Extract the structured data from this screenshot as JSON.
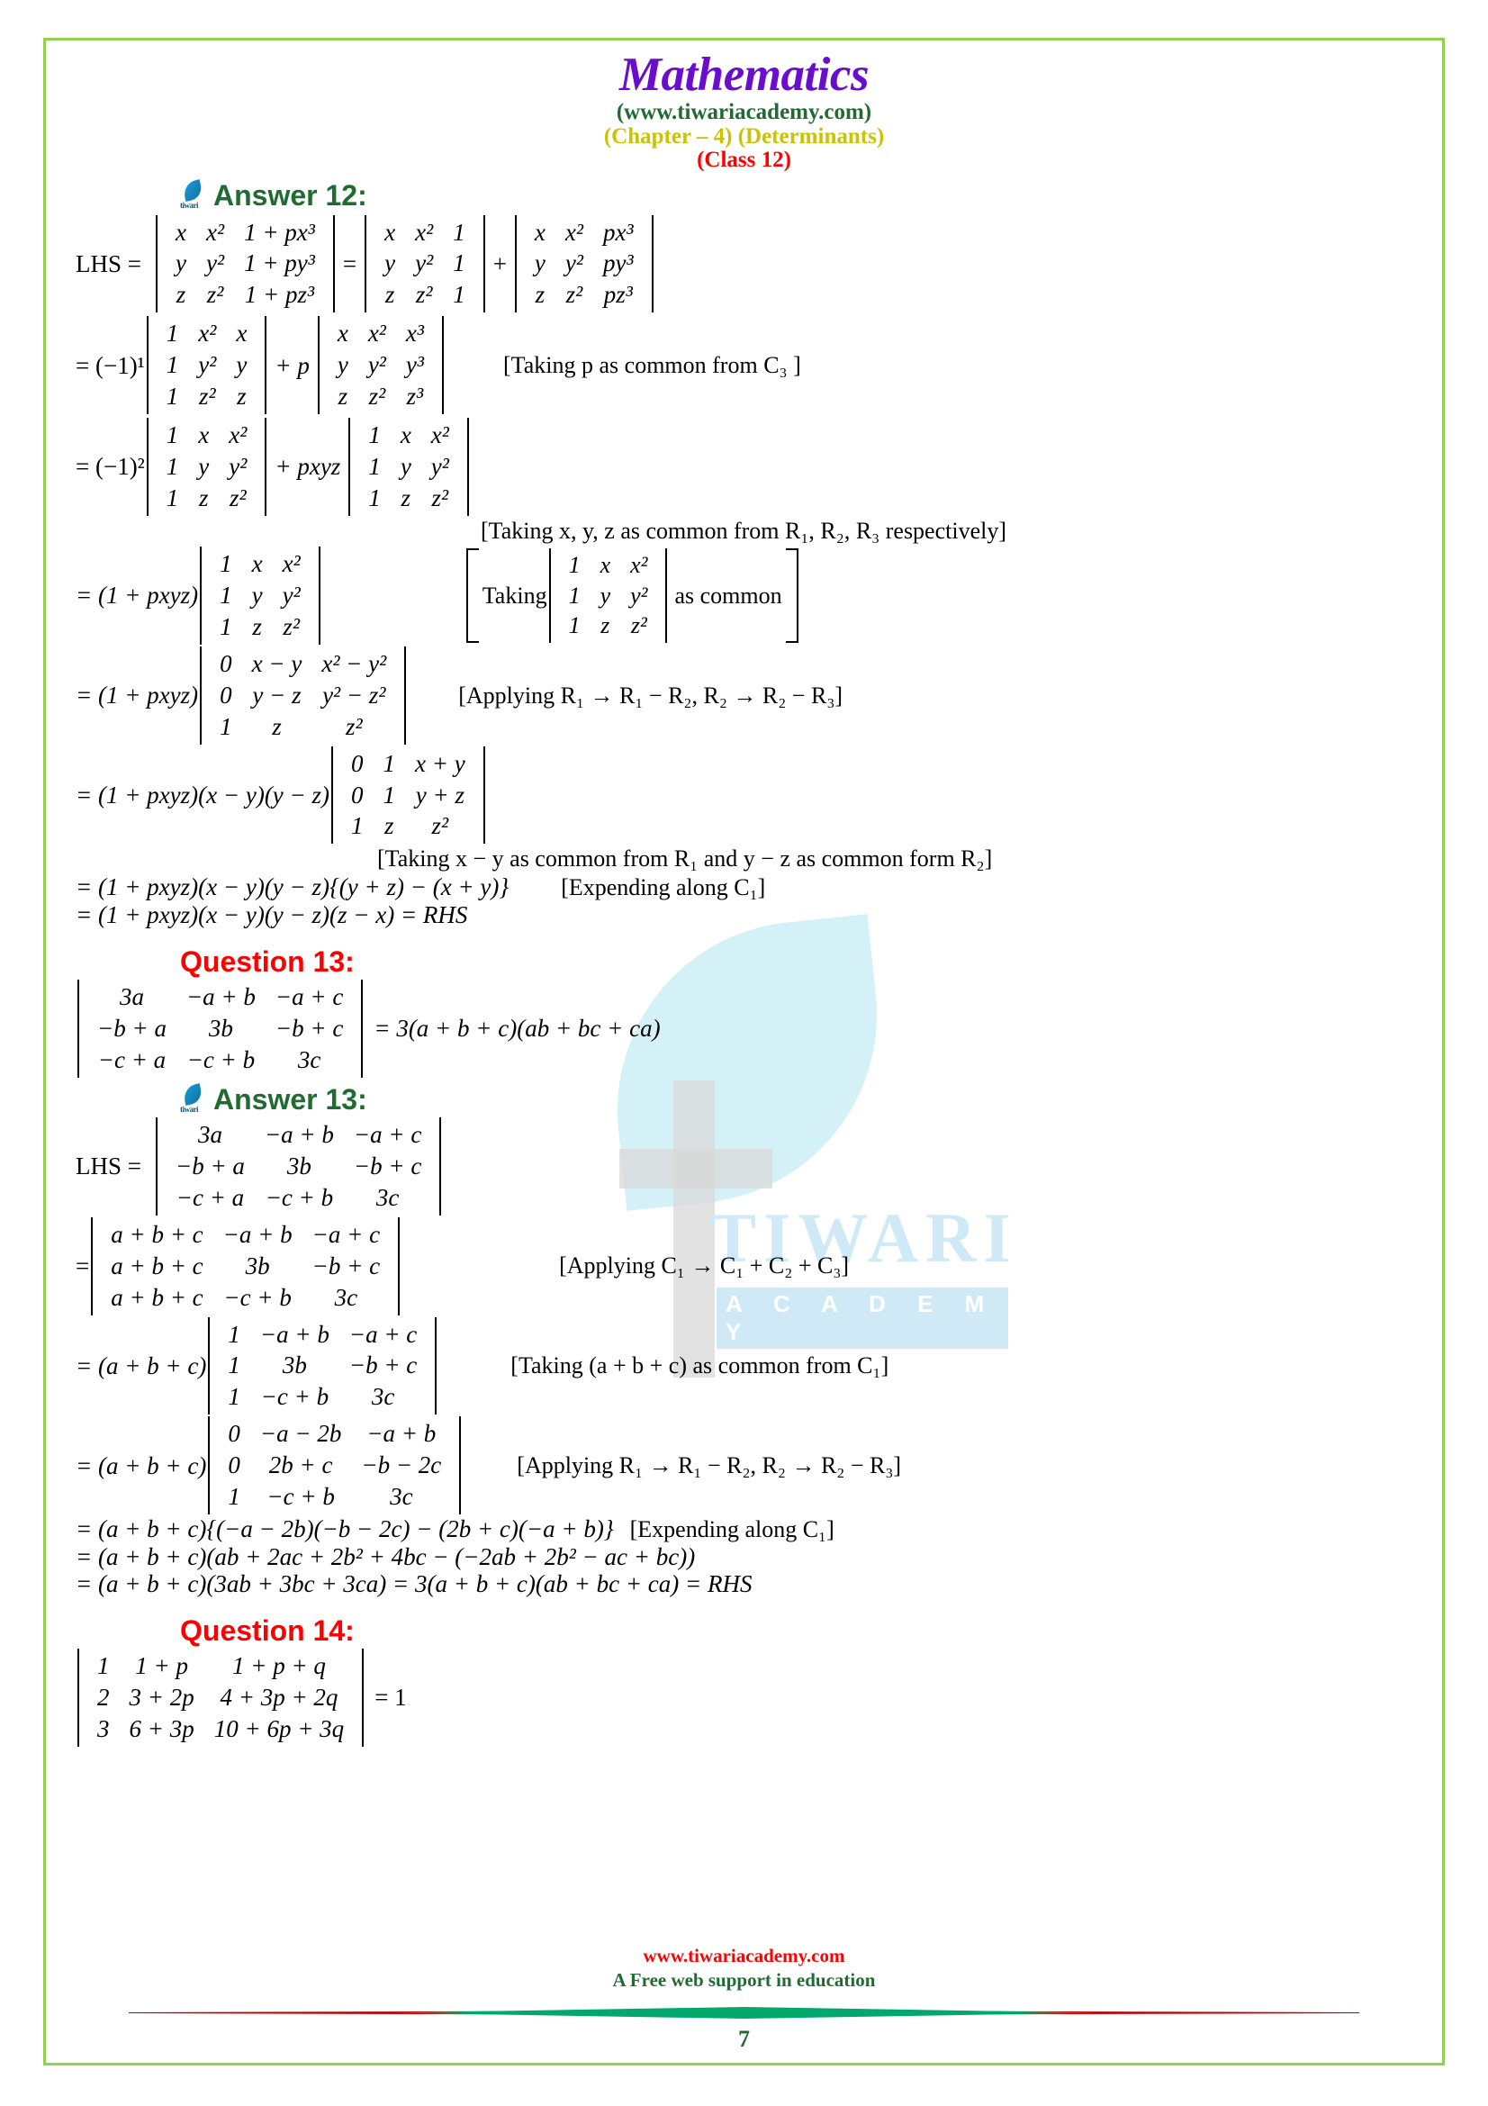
{
  "header": {
    "title": "Mathematics",
    "site": "(www.tiwariacademy.com)",
    "chapter": "(Chapter – 4) (Determinants)",
    "classline": "(Class 12)"
  },
  "watermark": {
    "brand": "TIWARI",
    "sub": "A C A D E M Y"
  },
  "answer12": {
    "heading": "Answer 12:",
    "lhs_label": "LHS =",
    "det1": {
      "rows": [
        [
          "x",
          "x²",
          "1 + px³"
        ],
        [
          "y",
          "y²",
          "1 + py³"
        ],
        [
          "z",
          "z²",
          "1 + pz³"
        ]
      ]
    },
    "eq1": "=",
    "det2": {
      "rows": [
        [
          "x",
          "x²",
          "1"
        ],
        [
          "y",
          "y²",
          "1"
        ],
        [
          "z",
          "z²",
          "1"
        ]
      ]
    },
    "plus1": "+",
    "det3": {
      "rows": [
        [
          "x",
          "x²",
          "px³"
        ],
        [
          "y",
          "y²",
          "py³"
        ],
        [
          "z",
          "z²",
          "pz³"
        ]
      ]
    },
    "line2_prefix": "= (−1)¹",
    "det4": {
      "rows": [
        [
          "1",
          "x²",
          "x"
        ],
        [
          "1",
          "y²",
          "y"
        ],
        [
          "1",
          "z²",
          "z"
        ]
      ]
    },
    "line2_mid": "+ p",
    "det5": {
      "rows": [
        [
          "x",
          "x²",
          "x³"
        ],
        [
          "y",
          "y²",
          "y³"
        ],
        [
          "z",
          "z²",
          "z³"
        ]
      ]
    },
    "note2": "[Taking p as common from C₃ ]",
    "line3_prefix": "= (−1)²",
    "det6": {
      "rows": [
        [
          "1",
          "x",
          "x²"
        ],
        [
          "1",
          "y",
          "y²"
        ],
        [
          "1",
          "z",
          "z²"
        ]
      ]
    },
    "line3_mid": "+ pxyz",
    "det7": {
      "rows": [
        [
          "1",
          "x",
          "x²"
        ],
        [
          "1",
          "y",
          "y²"
        ],
        [
          "1",
          "z",
          "z²"
        ]
      ]
    },
    "note3": "[Taking x, y, z as common from R₁, R₂, R₃ respectively]",
    "line4_prefix": "= (1 + pxyz)",
    "det8": {
      "rows": [
        [
          "1",
          "x",
          "x²"
        ],
        [
          "1",
          "y",
          "y²"
        ],
        [
          "1",
          "z",
          "z²"
        ]
      ]
    },
    "note4_open": "Taking",
    "det9": {
      "rows": [
        [
          "1",
          "x",
          "x²"
        ],
        [
          "1",
          "y",
          "y²"
        ],
        [
          "1",
          "z",
          "z²"
        ]
      ]
    },
    "note4_close": "as common",
    "line5_prefix": "= (1 + pxyz)",
    "det10": {
      "rows": [
        [
          "0",
          "x − y",
          "x² − y²"
        ],
        [
          "0",
          "y − z",
          "y² − z²"
        ],
        [
          "1",
          "z",
          "z²"
        ]
      ]
    },
    "note5": "[Applying R₁ → R₁ − R₂, R₂ → R₂ − R₃]",
    "line6_prefix": "= (1 + pxyz)(x − y)(y − z)",
    "det11": {
      "rows": [
        [
          "0",
          "1",
          "x + y"
        ],
        [
          "0",
          "1",
          "y + z"
        ],
        [
          "1",
          "z",
          "z²"
        ]
      ]
    },
    "note6": "[Taking x − y as common from R₁ and y − z as common form R₂]",
    "line7": "= (1 + pxyz)(x − y)(y − z){(y + z) − (x + y)}",
    "note7": "[Expending along C₁]",
    "line8": "= (1 + pxyz)(x − y)(y − z)(z − x) = RHS"
  },
  "question13": {
    "heading": "Question 13:",
    "det": {
      "rows": [
        [
          "3a",
          "−a + b",
          "−a + c"
        ],
        [
          "−b + a",
          "3b",
          "−b + c"
        ],
        [
          "−c + a",
          "−c + b",
          "3c"
        ]
      ]
    },
    "rhs": "= 3(a + b + c)(ab + bc + ca)"
  },
  "answer13": {
    "heading": "Answer 13:",
    "lhs_label": "LHS =",
    "det1": {
      "rows": [
        [
          "3a",
          "−a + b",
          "−a + c"
        ],
        [
          "−b + a",
          "3b",
          "−b + c"
        ],
        [
          "−c + a",
          "−c + b",
          "3c"
        ]
      ]
    },
    "line2_prefix": "=",
    "det2": {
      "rows": [
        [
          "a + b + c",
          "−a + b",
          "−a + c"
        ],
        [
          "a + b + c",
          "3b",
          "−b + c"
        ],
        [
          "a + b + c",
          "−c + b",
          "3c"
        ]
      ]
    },
    "note2": "[Applying C₁ → C₁ + C₂ + C₃]",
    "line3_prefix": "= (a + b + c)",
    "det3": {
      "rows": [
        [
          "1",
          "−a + b",
          "−a + c"
        ],
        [
          "1",
          "3b",
          "−b + c"
        ],
        [
          "1",
          "−c + b",
          "3c"
        ]
      ]
    },
    "note3": "[Taking (a + b + c) as common from C₁]",
    "line4_prefix": "= (a + b + c)",
    "det4": {
      "rows": [
        [
          "0",
          "−a − 2b",
          "−a + b"
        ],
        [
          "0",
          "2b + c",
          "−b − 2c"
        ],
        [
          "1",
          "−c + b",
          "3c"
        ]
      ]
    },
    "note4": "[Applying R₁ → R₁ − R₂, R₂ → R₂ − R₃]",
    "line5": "= (a + b + c){(−a − 2b)(−b − 2c) − (2b + c)(−a + b)}",
    "note5": "[Expending along C₁]",
    "line6": "= (a + b + c)(ab + 2ac + 2b² + 4bc − (−2ab + 2b² − ac + bc))",
    "line7": "= (a + b + c)(3ab + 3bc + 3ca) = 3(a + b + c)(ab + bc + ca) = RHS"
  },
  "question14": {
    "heading": "Question 14:",
    "det": {
      "rows": [
        [
          "1",
          "1 + p",
          "1 + p + q"
        ],
        [
          "2",
          "3 + 2p",
          "4 + 3p + 2q"
        ],
        [
          "3",
          "6 + 3p",
          "10 + 6p + 3q"
        ]
      ]
    },
    "rhs": "= 1"
  },
  "footer": {
    "url": "www.tiwariacademy.com",
    "tagline": "A Free web support in education",
    "page": "7"
  }
}
